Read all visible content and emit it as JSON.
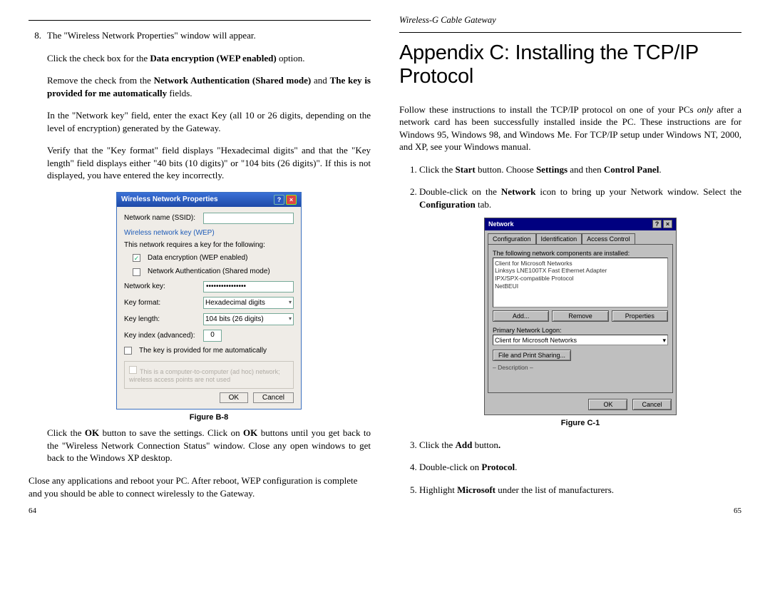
{
  "left": {
    "step_num": "8.",
    "p1": "The \"Wireless Network Properties\" window will appear.",
    "p2a": "Click the check box for the ",
    "p2b": "Data encryption (WEP enabled)",
    "p2c": " option.",
    "p3a": "Remove the check from the ",
    "p3b": "Network Authentication (Shared mode)",
    "p3c": " and ",
    "p3d": "The key is provided for me automatically",
    "p3e": " fields.",
    "p4": "In the \"Network key\" field, enter the exact Key (all 10 or 26 digits, depending on the level of encryption) generated by the Gateway.",
    "p5": "Verify that the \"Key format\" field displays \"Hexadecimal digits\" and that the \"Key length\" field displays either \"40 bits (10 digits)\" or \"104 bits (26 digits)\". If this is not displayed, you have entered the key incorrectly.",
    "fig_caption": "Figure B-8",
    "p6a": "Click the ",
    "p6b": "OK",
    "p6c": " button to save the settings.  Click on ",
    "p6d": "OK",
    "p6e": " buttons until you get back to the \"Wireless Network Connection Status\" window.  Close any open windows to get back to the Windows XP desktop.",
    "p7": "Close any applications and reboot your PC.  After reboot, WEP configuration is complete and you should be able to connect wirelessly to the Gateway.",
    "page_no": "64"
  },
  "xp": {
    "title": "Wireless Network Properties",
    "lbl_ssid": "Network name (SSID):",
    "grp": "Wireless network key (WEP)",
    "req": "This network requires a key for the following:",
    "chk_wep": "Data encryption (WEP enabled)",
    "chk_auth": "Network Authentication (Shared mode)",
    "lbl_key": "Network key:",
    "key_val": "••••••••••••••••",
    "lbl_fmt": "Key format:",
    "fmt_val": "Hexadecimal digits",
    "lbl_len": "Key length:",
    "len_val": "104 bits (26 digits)",
    "lbl_idx": "Key index (advanced):",
    "idx_val": "0",
    "chk_auto": "The key is provided for me automatically",
    "ghost": "This is a computer-to-computer (ad hoc) network; wireless access points are not used",
    "ok": "OK",
    "cancel": "Cancel"
  },
  "right": {
    "header": "Wireless-G Cable Gateway",
    "title": "Appendix C: Installing the TCP/IP Protocol",
    "intro_a": "Follow these instructions to install the TCP/IP protocol on one of your PCs ",
    "intro_b": "only",
    "intro_c": " after a network card has been successfully installed inside the PC. These instructions are for Windows 95, Windows 98, and Windows Me. For TCP/IP setup under Windows NT, 2000, and XP, see your Windows manual.",
    "s1a": "Click the ",
    "s1b": "Start",
    "s1c": " button. Choose ",
    "s1d": "Settings",
    "s1e": " and then ",
    "s1f": "Control Panel",
    "s1g": ".",
    "s2a": "Double-click on the ",
    "s2b": "Network",
    "s2c": " icon to bring up your Network window. Select the ",
    "s2d": "Configuration",
    "s2e": " tab.",
    "fig_caption": "Figure C-1",
    "s3a": "Click the ",
    "s3b": "Add",
    "s3c": " button",
    "s4a": "Double-click on ",
    "s4b": "Protocol",
    "s4c": ".",
    "s5a": "Highlight ",
    "s5b": "Microsoft",
    "s5c": " under the list of manufacturers.",
    "page_no": "65"
  },
  "w9": {
    "title": "Network",
    "tab1": "Configuration",
    "tab2": "Identification",
    "tab3": "Access Control",
    "top_txt": "The following network components are installed:",
    "list1": "Client for Microsoft Networks",
    "list2": "Linksys LNE100TX Fast Ethernet Adapter",
    "list3": "IPX/SPX-compatible Protocol",
    "list4": "NetBEUI",
    "btn_add": "Add...",
    "btn_rem": "Remove",
    "btn_prop": "Properties",
    "lbl_logon": "Primary Network Logon:",
    "dd_val": "Client for Microsoft Networks",
    "btn_fps": "File and Print Sharing...",
    "desc_lbl": "Description",
    "ok": "OK",
    "cancel": "Cancel"
  }
}
